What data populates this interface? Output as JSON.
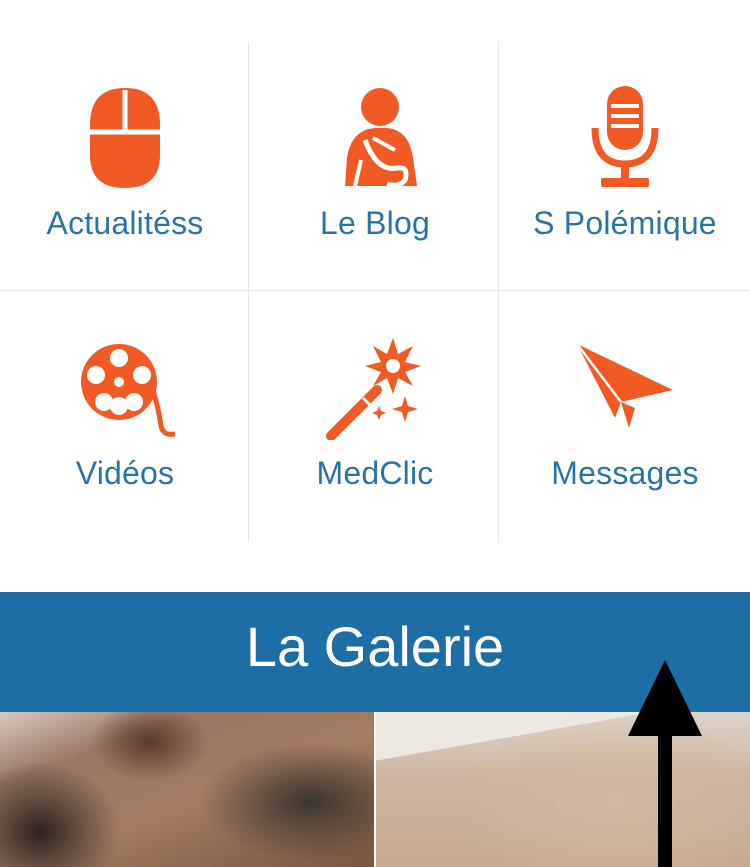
{
  "menu": {
    "items": [
      {
        "label": "Actualitéss",
        "icon": "mouse-icon"
      },
      {
        "label": "Le Blog",
        "icon": "injured-person-icon"
      },
      {
        "label": "S Polémique",
        "icon": "microphone-icon"
      },
      {
        "label": "Vidéos",
        "icon": "film-reel-icon"
      },
      {
        "label": "MedClic",
        "icon": "magic-wand-icon"
      },
      {
        "label": "Messages",
        "icon": "paper-plane-icon"
      }
    ]
  },
  "gallery": {
    "title": "La Galerie"
  },
  "colors": {
    "accent": "#f15a24",
    "label": "#2a74a6",
    "banner": "#1e6ea6"
  }
}
